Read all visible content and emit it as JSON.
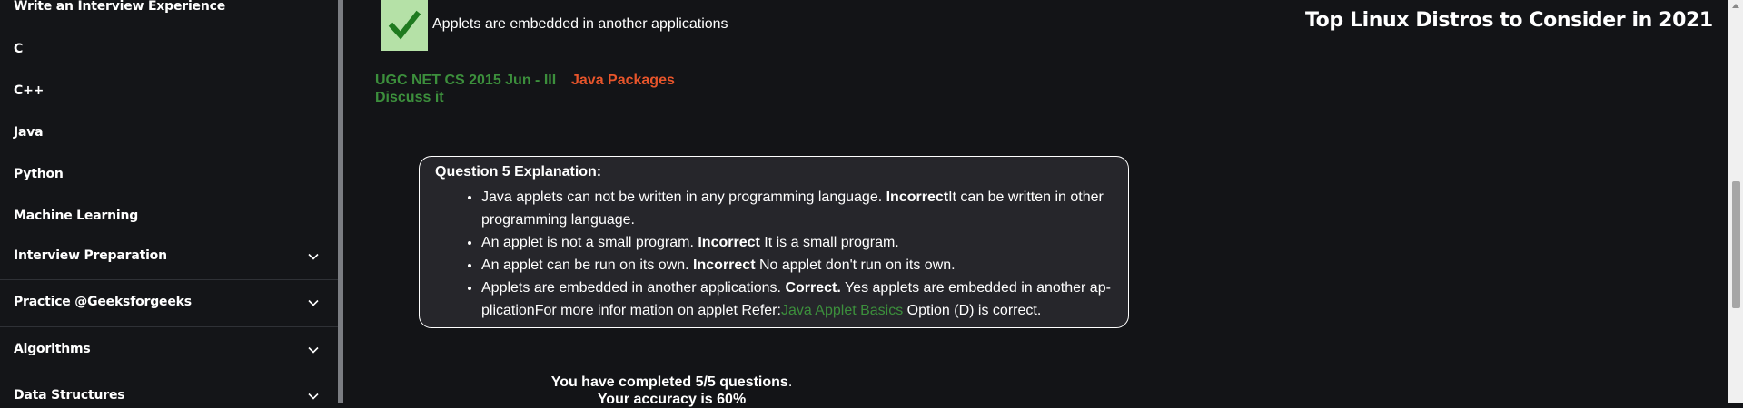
{
  "sidebar": {
    "items": [
      {
        "label": "Write an Interview Experience"
      },
      {
        "label": "C"
      },
      {
        "label": "C++"
      },
      {
        "label": "Java"
      },
      {
        "label": "Python"
      },
      {
        "label": "Machine Learning"
      }
    ],
    "sections": [
      {
        "label": "Interview Preparation"
      },
      {
        "label": "Practice @Geeksforgeeks"
      },
      {
        "label": "Algorithms"
      },
      {
        "label": "Data Structures"
      }
    ]
  },
  "answer": {
    "text": "Applets are embedded in another applications"
  },
  "tags": {
    "exam": "UGC NET CS 2015 Jun - III",
    "topic": "Java Packages",
    "discuss": "Discuss it"
  },
  "trending": {
    "title": "Top Linux Distros to Consider in 2021"
  },
  "explanation": {
    "title": "Question 5 Explanation:",
    "b1_pre": "Java applets can not be written in any programming language. ",
    "b1_bold": "Incorrect",
    "b1_post": "It can be written in other programming language.",
    "b2_pre": "An applet is not a small program. ",
    "b2_bold": "Incorrect",
    "b2_post": " It is a small program.",
    "b3_pre": "An applet can be run on its own. ",
    "b3_bold": "Incorrect",
    "b3_post": " No applet don't run on its own.",
    "b4_pre": "Applets are embedded in another applications. ",
    "b4_bold": "Correct.",
    "b4_post": " Yes applets are embedded in another ap-plicationFor more infor mation on applet Refer:",
    "b4_link": "Java Applet Basics",
    "b4_tail": " Option (D) is correct."
  },
  "result": {
    "completed_pre": "You have completed ",
    "completed_val": "5/5",
    "completed_post": " questions",
    "completed_dot": ".",
    "accuracy_pre": "Your accuracy is ",
    "accuracy_val": "60%"
  },
  "colors": {
    "background": "#131417",
    "green": "#3c8f3c",
    "orange": "#e8552b",
    "check_bg": "#b5e1a7",
    "check_mark": "#1f7a1f"
  }
}
